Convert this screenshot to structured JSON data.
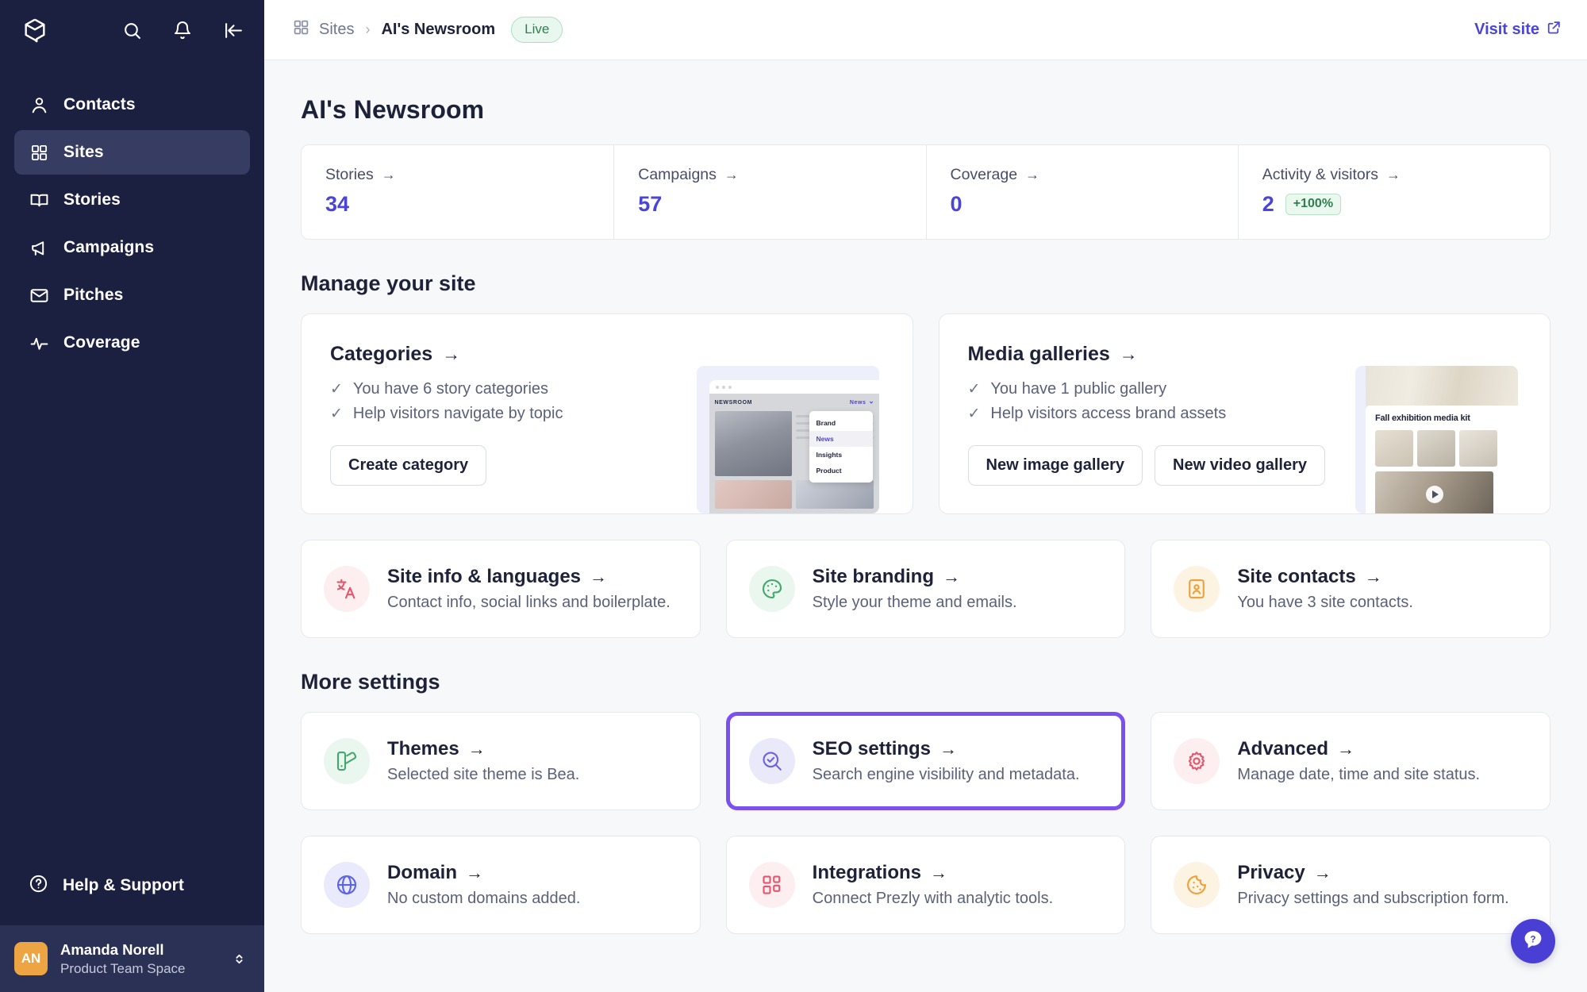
{
  "sidebar": {
    "logo_icon": "prezly-cube-logo",
    "top_actions": [
      {
        "name": "search-icon",
        "label": "Search"
      },
      {
        "name": "bell-icon",
        "label": "Notifications"
      },
      {
        "name": "collapse-sidebar-icon",
        "label": "Collapse sidebar"
      }
    ],
    "items": [
      {
        "label": "Contacts",
        "icon": "user-icon",
        "active": false
      },
      {
        "label": "Sites",
        "icon": "grid-icon",
        "active": true
      },
      {
        "label": "Stories",
        "icon": "book-icon",
        "active": false
      },
      {
        "label": "Campaigns",
        "icon": "megaphone-icon",
        "active": false
      },
      {
        "label": "Pitches",
        "icon": "envelope-icon",
        "active": false
      },
      {
        "label": "Coverage",
        "icon": "activity-icon",
        "active": false
      }
    ],
    "help": {
      "label": "Help & Support",
      "icon": "question-circle-icon"
    },
    "user": {
      "initials": "AN",
      "name": "Amanda Norell",
      "space": "Product Team Space",
      "avatar_color": "#eda544"
    }
  },
  "topbar": {
    "breadcrumb_root": "Sites",
    "breadcrumb_separator": "›",
    "breadcrumb_current": "AI's Newsroom",
    "status_badge": "Live",
    "visit_site": "Visit site",
    "visit_site_icon": "external-link-icon"
  },
  "page": {
    "title": "AI's Newsroom",
    "stats": [
      {
        "label": "Stories",
        "value": "34",
        "delta": null
      },
      {
        "label": "Campaigns",
        "value": "57",
        "delta": null
      },
      {
        "label": "Coverage",
        "value": "0",
        "delta": null
      },
      {
        "label": "Activity & visitors",
        "value": "2",
        "delta": "+100%"
      }
    ],
    "manage_section_title": "Manage your site",
    "big_cards": [
      {
        "title": "Categories",
        "checks": [
          "You have 6 story categories",
          "Help visitors navigate by topic"
        ],
        "buttons": [
          "Create category"
        ],
        "thumb": {
          "type": "categories-browser",
          "nav_brand": "NEWSROOM",
          "nav_current": "News",
          "menu": [
            "Brand",
            "News",
            "Insights",
            "Product"
          ],
          "menu_selected": "News"
        }
      },
      {
        "title": "Media galleries",
        "checks": [
          "You have 1 public gallery",
          "Help visitors access brand assets"
        ],
        "buttons": [
          "New image gallery",
          "New video gallery"
        ],
        "thumb": {
          "type": "media-gallery",
          "gallery_title": "Fall exhibition media kit"
        }
      }
    ],
    "manage_cards": [
      {
        "title": "Site info & languages",
        "subtitle": "Contact info, social links and boilerplate.",
        "icon": "translate-icon",
        "icon_color": "#e2576e",
        "icon_bg": "#fdeef0",
        "highlighted": false
      },
      {
        "title": "Site branding",
        "subtitle": "Style your theme and emails.",
        "icon": "palette-icon",
        "icon_color": "#44a86d",
        "icon_bg": "#e9f7ef",
        "highlighted": false
      },
      {
        "title": "Site contacts",
        "subtitle": "You have 3 site contacts.",
        "icon": "contact-card-icon",
        "icon_color": "#eda13a",
        "icon_bg": "#fdf3e3",
        "highlighted": false
      }
    ],
    "more_section_title": "More settings",
    "more_cards": [
      {
        "title": "Themes",
        "subtitle": "Selected site theme is Bea.",
        "icon": "theme-swatch-icon",
        "icon_color": "#44a86d",
        "icon_bg": "#e9f7ef",
        "highlighted": false
      },
      {
        "title": "SEO settings",
        "subtitle": "Search engine visibility and metadata.",
        "icon": "search-check-icon",
        "icon_color": "#6c63e0",
        "icon_bg": "#e9e9fa",
        "highlighted": true
      },
      {
        "title": "Advanced",
        "subtitle": "Manage date, time and site status.",
        "icon": "gear-icon",
        "icon_color": "#e2576e",
        "icon_bg": "#fdeef0",
        "highlighted": false
      },
      {
        "title": "Domain",
        "subtitle": "No custom domains added.",
        "icon": "globe-icon",
        "icon_color": "#5b63e8",
        "icon_bg": "#e9eafb",
        "highlighted": false
      },
      {
        "title": "Integrations",
        "subtitle": "Connect Prezly with analytic tools.",
        "icon": "blocks-icon",
        "icon_color": "#e2576e",
        "icon_bg": "#fdeef0",
        "highlighted": false
      },
      {
        "title": "Privacy",
        "subtitle": "Privacy settings and subscription form.",
        "icon": "cookie-icon",
        "icon_color": "#eda13a",
        "icon_bg": "#fdf3e3",
        "highlighted": false
      }
    ],
    "arrow_glyph": "→",
    "check_glyph": "✓",
    "help_fab_icon": "help-chat-icon",
    "highlight_color": "#7b4ff0",
    "accent_color": "#4a45d6"
  }
}
